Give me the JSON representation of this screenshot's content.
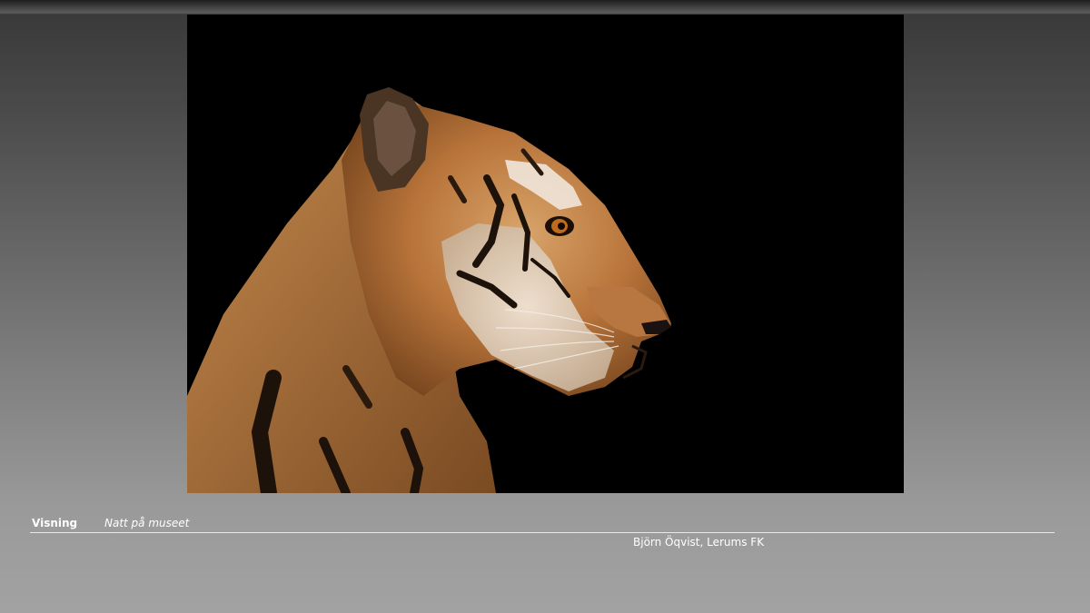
{
  "slide": {
    "category": "Visning",
    "title": "Natt på museet",
    "author": "Björn Öqvist, Lerums FK"
  },
  "photo": {
    "subject": "tiger-head-profile",
    "background_color": "#000000"
  },
  "colors": {
    "caption_text": "#ffffff",
    "rule": "#e8e8e8"
  }
}
